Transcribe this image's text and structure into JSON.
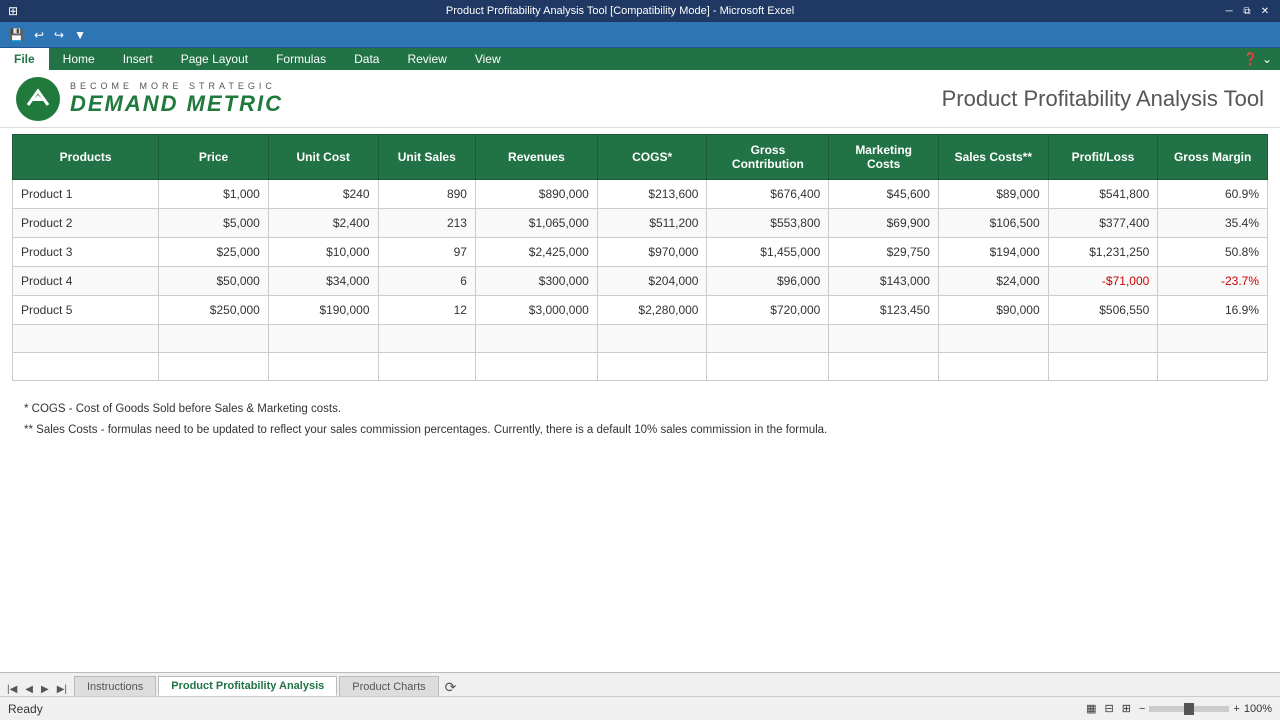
{
  "titlebar": {
    "title": "Product Profitability Analysis Tool [Compatibility Mode] - Microsoft Excel"
  },
  "ribbon": {
    "tabs": [
      "File",
      "Home",
      "Insert",
      "Page Layout",
      "Formulas",
      "Data",
      "Review",
      "View"
    ],
    "active_tab": "File"
  },
  "header": {
    "logo_become": "Become  More  Strategic",
    "logo_demand": "Demand Metric",
    "app_title": "Product Profitability Analysis Tool"
  },
  "table": {
    "columns": [
      "Products",
      "Price",
      "Unit Cost",
      "Unit Sales",
      "Revenues",
      "COGS*",
      "Gross\nContribution",
      "Marketing\nCosts",
      "Sales Costs**",
      "Profit/Loss",
      "Gross Margin"
    ],
    "rows": [
      {
        "product": "Product 1",
        "price": "$1,000",
        "unit_cost": "$240",
        "unit_sales": "890",
        "revenues": "$890,000",
        "cogs": "$213,600",
        "gross_contribution": "$676,400",
        "marketing_costs": "$45,600",
        "sales_costs": "$89,000",
        "profit_loss": "$541,800",
        "gross_margin": "60.9%",
        "negative": false
      },
      {
        "product": "Product 2",
        "price": "$5,000",
        "unit_cost": "$2,400",
        "unit_sales": "213",
        "revenues": "$1,065,000",
        "cogs": "$511,200",
        "gross_contribution": "$553,800",
        "marketing_costs": "$69,900",
        "sales_costs": "$106,500",
        "profit_loss": "$377,400",
        "gross_margin": "35.4%",
        "negative": false
      },
      {
        "product": "Product 3",
        "price": "$25,000",
        "unit_cost": "$10,000",
        "unit_sales": "97",
        "revenues": "$2,425,000",
        "cogs": "$970,000",
        "gross_contribution": "$1,455,000",
        "marketing_costs": "$29,750",
        "sales_costs": "$194,000",
        "profit_loss": "$1,231,250",
        "gross_margin": "50.8%",
        "negative": false
      },
      {
        "product": "Product 4",
        "price": "$50,000",
        "unit_cost": "$34,000",
        "unit_sales": "6",
        "revenues": "$300,000",
        "cogs": "$204,000",
        "gross_contribution": "$96,000",
        "marketing_costs": "$143,000",
        "sales_costs": "$24,000",
        "profit_loss": "-$71,000",
        "gross_margin": "-23.7%",
        "negative": true
      },
      {
        "product": "Product 5",
        "price": "$250,000",
        "unit_cost": "$190,000",
        "unit_sales": "12",
        "revenues": "$3,000,000",
        "cogs": "$2,280,000",
        "gross_contribution": "$720,000",
        "marketing_costs": "$123,450",
        "sales_costs": "$90,000",
        "profit_loss": "$506,550",
        "gross_margin": "16.9%",
        "negative": false
      }
    ]
  },
  "notes": {
    "note1": "* COGS - Cost of Goods Sold before Sales & Marketing costs.",
    "note2": "** Sales Costs - formulas need to be updated to reflect your sales commission percentages.  Currently, there is a default 10% sales commission in the formula."
  },
  "sheet_tabs": {
    "tabs": [
      "Instructions",
      "Product Profitability Analysis",
      "Product Charts"
    ],
    "active": "Product Profitability Analysis"
  },
  "status": {
    "ready": "Ready",
    "zoom": "100%"
  }
}
